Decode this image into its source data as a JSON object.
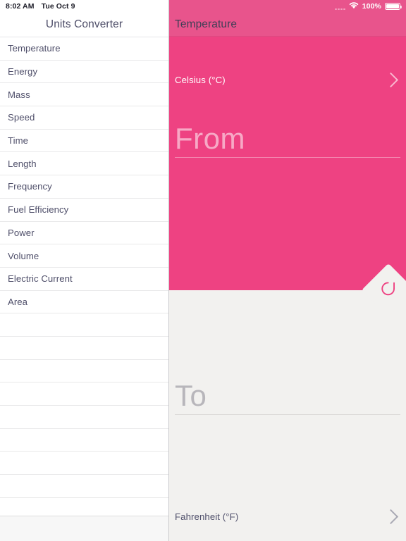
{
  "status_bar": {
    "time": "8:02 AM",
    "date": "Tue Oct 9",
    "battery_percent": "100%",
    "wifi_icon": "wifi-icon",
    "battery_icon": "battery-full-icon",
    "signal_dots_icon": "signal-dots-icon"
  },
  "sidebar": {
    "title": "Units Converter",
    "items": [
      {
        "label": "Temperature"
      },
      {
        "label": "Energy"
      },
      {
        "label": "Mass"
      },
      {
        "label": "Speed"
      },
      {
        "label": "Time"
      },
      {
        "label": "Length"
      },
      {
        "label": "Frequency"
      },
      {
        "label": "Fuel Efficiency"
      },
      {
        "label": "Power"
      },
      {
        "label": "Volume"
      },
      {
        "label": "Electric Current"
      },
      {
        "label": "Area"
      },
      {
        "label": ""
      },
      {
        "label": ""
      },
      {
        "label": ""
      },
      {
        "label": ""
      },
      {
        "label": ""
      },
      {
        "label": ""
      },
      {
        "label": ""
      },
      {
        "label": ""
      }
    ]
  },
  "detail": {
    "title": "Temperature",
    "from": {
      "unit": "Celsius (°C)",
      "value_placeholder": "From",
      "chevron_icon": "chevron-right-icon"
    },
    "to": {
      "unit": "Fahrenheit (°F)",
      "value_placeholder": "To",
      "chevron_icon": "chevron-right-icon"
    },
    "swap_icon": "swap-refresh-icon"
  },
  "colors": {
    "accent_pink": "#ee4282",
    "header_pink": "#e8548c",
    "panel_gray": "#f2f1ef",
    "text_slate": "#4f4f6a"
  }
}
